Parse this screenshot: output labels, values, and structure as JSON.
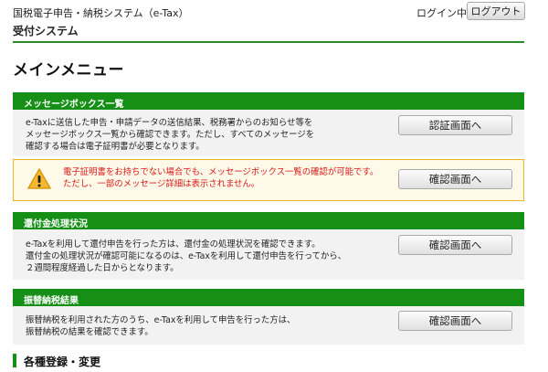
{
  "header": {
    "system_name": "国税電子申告・納税システム（e-Tax）",
    "subsystem": "受付システム",
    "login_status": "ログイン中",
    "logout_label": "ログアウト"
  },
  "main": {
    "title": "メインメニュー"
  },
  "sections": {
    "message_box": {
      "title": "メッセージボックス一覧",
      "lines": [
        "e-Taxに送信した申告・申請データの送信結果、税務署からのお知らせ等を",
        "メッセージボックス一覧から確認できます。ただし、すべてのメッセージを",
        "確認する場合は電子証明書が必要となります。"
      ],
      "button_label": "認証画面へ"
    },
    "notice": {
      "icon": "warning-icon",
      "lines": [
        "電子証明書をお持ちでない場合でも、メッセージボックス一覧の確認が可能です。",
        "ただし、一部のメッセージ詳細は表示されません。"
      ],
      "button_label": "確認画面へ"
    },
    "refund": {
      "title": "還付金処理状況",
      "lines": [
        "e-Taxを利用して還付申告を行った方は、還付金の処理状況を確認できます。",
        "還付金の処理状況が確認可能になるのは、e-Taxを利用して還付申告を行ってから、",
        "２週間程度経過した日からとなります。"
      ],
      "button_label": "確認画面へ"
    },
    "transfer": {
      "title": "振替納税結果",
      "lines": [
        "振替納税を利用された方のうち、e-Taxを利用して申告を行った方は、",
        "振替納税の結果を確認できます。"
      ],
      "button_label": "確認画面へ"
    }
  },
  "registration": {
    "title": "各種登録・変更"
  },
  "colors": {
    "accent_green": "#158f15",
    "warning_border": "#f0b422",
    "warning_text": "#d91818"
  }
}
